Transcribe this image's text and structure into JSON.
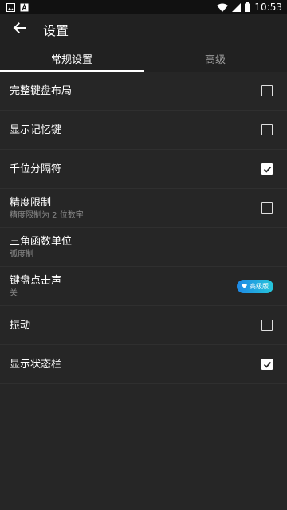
{
  "status_bar": {
    "time": "10:53",
    "left_icons": [
      "image-icon",
      "text-a-icon"
    ],
    "right_icons": [
      "wifi-icon",
      "signal-icon",
      "battery-icon"
    ]
  },
  "header": {
    "title": "设置",
    "back_icon": "arrow-left-icon"
  },
  "tabs": [
    {
      "label": "常规设置",
      "active": true
    },
    {
      "label": "高级",
      "active": false
    }
  ],
  "settings": [
    {
      "title": "完整键盘布局",
      "subtitle": "",
      "control": "checkbox",
      "checked": false
    },
    {
      "title": "显示记忆键",
      "subtitle": "",
      "control": "checkbox",
      "checked": false
    },
    {
      "title": "千位分隔符",
      "subtitle": "",
      "control": "checkbox",
      "checked": true
    },
    {
      "title": "精度限制",
      "subtitle": "精度限制为 2 位数字",
      "control": "checkbox",
      "checked": false
    },
    {
      "title": "三角函数单位",
      "subtitle": "弧度制",
      "control": "none"
    },
    {
      "title": "键盘点击声",
      "subtitle": "关",
      "control": "badge",
      "badge_label": "高级版",
      "badge_icon": "diamond-icon"
    },
    {
      "title": "振动",
      "subtitle": "",
      "control": "checkbox",
      "checked": false
    },
    {
      "title": "显示状态栏",
      "subtitle": "",
      "control": "checkbox",
      "checked": true
    }
  ],
  "colors": {
    "background": "#262626",
    "toolbar": "#212121",
    "status_bar": "#111111",
    "badge_gradient_start": "#1e88e5",
    "badge_gradient_end": "#26c6da"
  }
}
